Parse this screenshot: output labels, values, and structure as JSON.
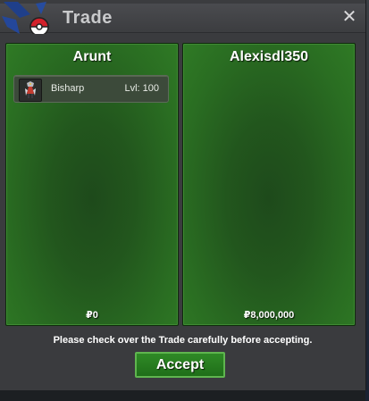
{
  "window": {
    "title": "Trade",
    "close_glyph": "✕"
  },
  "icons": {
    "logo": "pokeball-logo-icon",
    "close": "close-icon",
    "pokemon": "bisharp-sprite-icon"
  },
  "left_panel": {
    "trainer_name": "Arunt",
    "items": [
      {
        "name": "Bisharp",
        "level_label": "Lvl: 100"
      }
    ],
    "money": "₽0"
  },
  "right_panel": {
    "trainer_name": "Alexisdl350",
    "items": [],
    "money": "₽8,000,000"
  },
  "footer": {
    "notice": "Please check over the Trade carefully before accepting.",
    "accept_label": "Accept"
  },
  "colors": {
    "panel_green": "#2a6e22",
    "button_green": "#2f8a26",
    "window_bg": "#3a3b3e"
  }
}
